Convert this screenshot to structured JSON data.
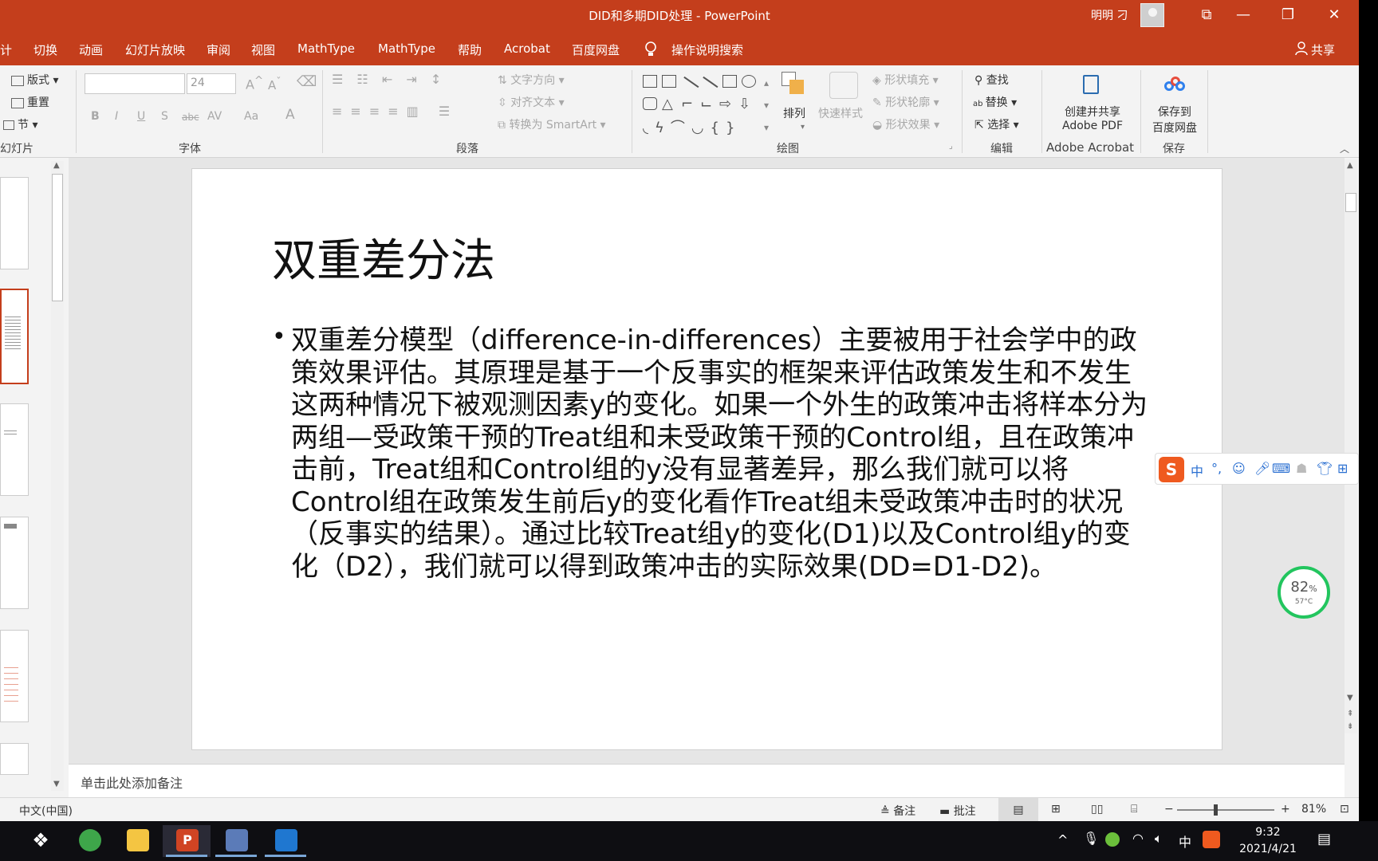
{
  "window": {
    "title": "DID和多期DID处理 - PowerPoint",
    "user": "明明 刁",
    "controls": {
      "restore": "⧉",
      "minimize": "—",
      "maximize": "❐",
      "close": "✕"
    }
  },
  "tabs": [
    "计",
    "切换",
    "动画",
    "幻灯片放映",
    "审阅",
    "视图",
    "MathType",
    "MathType",
    "帮助",
    "Acrobat",
    "百度网盘",
    "操作说明搜索"
  ],
  "share_label": "共享",
  "ribbon": {
    "slides_group": {
      "layout": "版式",
      "reset": "重置",
      "section": "节",
      "label": "幻灯片"
    },
    "font_group": {
      "font_name": "",
      "font_size": "24",
      "bold": "B",
      "italic": "I",
      "underline": "U",
      "shadow": "S",
      "strike": "abc",
      "spacing": "AV",
      "case": "Aa",
      "color": "A",
      "label": "字体"
    },
    "paragraph_group": {
      "text_direction": "文字方向",
      "align_text": "对齐文本",
      "convert_smartart": "转换为 SmartArt",
      "label": "段落"
    },
    "drawing_group": {
      "arrange": "排列",
      "quick_styles": "快速样式",
      "shape_fill": "形状填充",
      "shape_outline": "形状轮廓",
      "shape_effects": "形状效果",
      "label": "绘图"
    },
    "editing_group": {
      "find": "查找",
      "replace": "替换",
      "select": "选择",
      "label": "编辑"
    },
    "acrobat_group": {
      "create_pdf_line1": "创建并共享",
      "create_pdf_line2": "Adobe PDF",
      "label": "Adobe Acrobat"
    },
    "save_group": {
      "save_line1": "保存到",
      "save_line2": "百度网盘",
      "label": "保存"
    }
  },
  "slide": {
    "title": "双重差分法",
    "bullet": "•",
    "body": "双重差分模型（difference-in-differences）主要被用于社会学中的政策效果评估。其原理是基于一个反事实的框架来评估政策发生和不发生这两种情况下被观测因素y的变化。如果一个外生的政策冲击将样本分为两组—受政策干预的Treat组和未受政策干预的Control组，且在政策冲击前，Treat组和Control组的y没有显著差异，那么我们就可以将Control组在政策发生前后y的变化看作Treat组未受政策冲击时的状况（反事实的结果）。通过比较Treat组y的变化(D1)以及Control组y的变化（D2），我们就可以得到政策冲击的实际效果(DD=D1-D2)。"
  },
  "notes_placeholder": "单击此处添加备注",
  "status": {
    "language": "中文(中国)",
    "notes": "备注",
    "comments": "批注",
    "zoom_minus": "−",
    "zoom_plus": "+",
    "zoom": "81%",
    "zoom_level": 0.81
  },
  "ime_toolbar": {
    "logo": "S",
    "mode": "中",
    "punct": "°,",
    "items": [
      "emoji-icon",
      "mic-icon",
      "keyboard-icon",
      "skin-icon",
      "tshirt-icon",
      "grid-icon"
    ]
  },
  "monitor": {
    "percent": "82",
    "percent_sign": "%",
    "temp": "57°C"
  },
  "taskbar": {
    "time": "9:32",
    "date": "2021/4/21",
    "ime": "中",
    "tray_chevron": "^"
  },
  "colors": {
    "accent": "#c43e1c",
    "taskbar": "#0e0e12",
    "gauge": "#22c55e"
  }
}
